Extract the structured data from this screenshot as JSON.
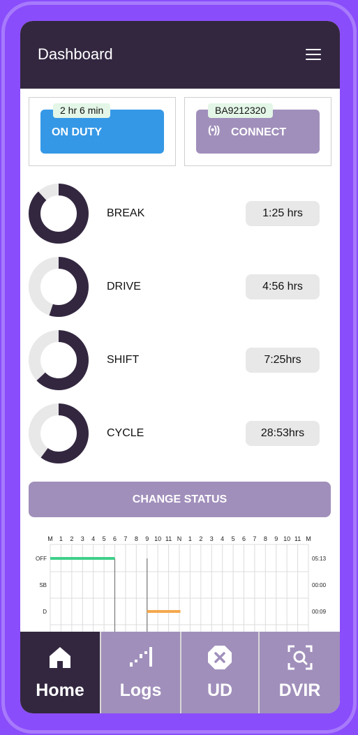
{
  "header": {
    "title": "Dashboard"
  },
  "status": {
    "duty": {
      "label": "ON DUTY",
      "timer": "2 hr 6 min",
      "color": "#3598e6"
    },
    "connect": {
      "label": "CONNECT",
      "device_id": "BA9212320",
      "color": "#a08fbb"
    }
  },
  "timers": [
    {
      "label": "BREAK",
      "value": "1:25 hrs",
      "fraction": 0.88
    },
    {
      "label": "DRIVE",
      "value": "4:56 hrs",
      "fraction": 0.55
    },
    {
      "label": "SHIFT",
      "value": "7:25hrs",
      "fraction": 0.63
    },
    {
      "label": "CYCLE",
      "value": "28:53hrs",
      "fraction": 0.6
    }
  ],
  "actions": {
    "change_status": "CHANGE STATUS"
  },
  "log_chart": {
    "hours": [
      "M",
      "1",
      "2",
      "3",
      "4",
      "5",
      "6",
      "7",
      "8",
      "9",
      "10",
      "11",
      "N",
      "1",
      "2",
      "3",
      "4",
      "5",
      "6",
      "7",
      "8",
      "9",
      "10",
      "11",
      "M"
    ],
    "rows": [
      {
        "label": "OFF",
        "total": "05:13"
      },
      {
        "label": "SB",
        "total": "00:00"
      },
      {
        "label": "D",
        "total": "00:09"
      }
    ],
    "segments": [
      {
        "row": 0,
        "start": 0,
        "end": 6.0,
        "color": "#3ed18a"
      },
      {
        "row": 2,
        "start": 9.0,
        "end": 12.1,
        "color": "#f5a84d"
      }
    ],
    "transitions": [
      6.0,
      9.0
    ]
  },
  "nav": {
    "items": [
      {
        "label": "Home",
        "icon": "home-icon",
        "active": true
      },
      {
        "label": "Logs",
        "icon": "logs-icon",
        "active": false
      },
      {
        "label": "UD",
        "icon": "ud-icon",
        "active": false
      },
      {
        "label": "DVIR",
        "icon": "dvir-icon",
        "active": false
      }
    ]
  }
}
